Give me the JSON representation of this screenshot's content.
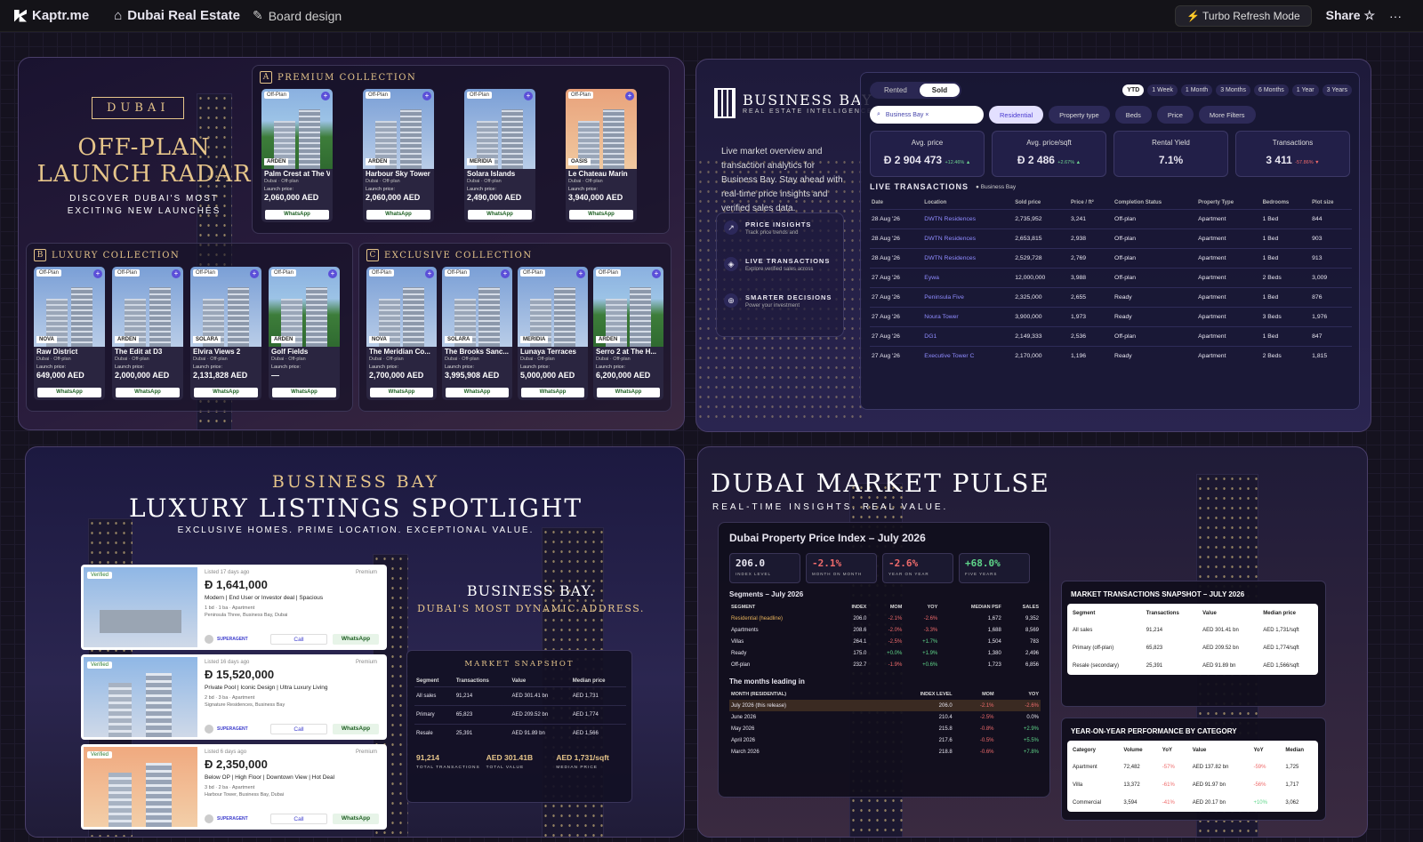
{
  "topbar": {
    "app_name": "Kaptr.me",
    "board_name": "Dubai Real Estate",
    "board_action": "Board design",
    "turbo": "⚡ Turbo Refresh Mode",
    "share": "Share",
    "more": "···"
  },
  "offplan": {
    "tag": "DUBAI",
    "title_1": "OFF-PLAN",
    "title_2": "LAUNCH RADAR",
    "sub_1": "DISCOVER DUBAI'S MOST",
    "sub_2": "EXCITING NEW LAUNCHES",
    "collections": [
      {
        "badge": "A",
        "title": "PREMIUM COLLECTION",
        "cards": [
          {
            "dev": "ARDEN",
            "name": "Palm Crest at The Valley",
            "meta": "Dubai · Off-plan",
            "launch": "Launch price:",
            "price": "2,060,000 AED",
            "img": "g"
          },
          {
            "dev": "ARDEN",
            "name": "Harbour Sky Tower",
            "meta": "Dubai · Off-plan",
            "launch": "Launch price:",
            "price": "2,060,000 AED",
            "img": "b"
          },
          {
            "dev": "MERIDIA",
            "name": "Solara Islands",
            "meta": "Dubai · Off-plan",
            "launch": "Launch price:",
            "price": "2,490,000 AED",
            "img": "b"
          },
          {
            "dev": "OASIS",
            "name": "Le Chateau Marin",
            "meta": "Dubai · Off-plan",
            "launch": "Launch price:",
            "price": "3,940,000 AED",
            "img": "o"
          }
        ]
      },
      {
        "badge": "B",
        "title": "LUXURY COLLECTION",
        "cards": [
          {
            "dev": "NOVA",
            "name": "Raw District",
            "meta": "Dubai · Off-plan",
            "launch": "Launch price:",
            "price": "649,000 AED",
            "img": "b"
          },
          {
            "dev": "ARDEN",
            "name": "The Edit at D3",
            "meta": "Dubai · Off-plan",
            "launch": "Launch price:",
            "price": "2,000,000 AED",
            "img": "b"
          },
          {
            "dev": "SOLARA",
            "name": "Elvira Views 2",
            "meta": "Dubai · Off-plan",
            "launch": "Launch price:",
            "price": "2,131,828 AED",
            "img": "b"
          },
          {
            "dev": "ARDEN",
            "name": "Golf Fields",
            "meta": "Dubai · Off-plan",
            "launch": "Launch price:",
            "price": "—",
            "img": "g"
          }
        ]
      },
      {
        "badge": "C",
        "title": "EXCLUSIVE COLLECTION",
        "cards": [
          {
            "dev": "NOVA",
            "name": "The Meridian Co...",
            "meta": "Dubai · Off-plan",
            "launch": "Launch price:",
            "price": "2,700,000 AED",
            "img": "b"
          },
          {
            "dev": "SOLARA",
            "name": "The Brooks Sanc...",
            "meta": "Dubai · Off-plan",
            "launch": "Launch price:",
            "price": "3,995,908 AED",
            "img": "b"
          },
          {
            "dev": "MERIDIA",
            "name": "Lunaya Terraces",
            "meta": "Dubai · Off-plan",
            "launch": "Launch price:",
            "price": "5,000,000 AED",
            "img": "b"
          },
          {
            "dev": "ARDEN",
            "name": "Serro 2 at The H...",
            "meta": "Dubai · Off-plan",
            "launch": "Launch price:",
            "price": "6,200,000 AED",
            "img": "g"
          }
        ]
      }
    ],
    "card_tag": "Off-Plan",
    "whatsapp": "WhatsApp"
  },
  "bb": {
    "title": "BUSINESS BAY",
    "subtitle": "REAL ESTATE INTELLIGENCE",
    "desc": "Live market overview and transaction analytics for Business Bay. Stay ahead with real-time price insights and verified sales data.",
    "features": [
      {
        "h": "PRICE INSIGHTS",
        "d": "Track price trends and",
        "icon": "↗"
      },
      {
        "h": "LIVE TRANSACTIONS",
        "d": "Explore verified sales across",
        "icon": "◈"
      },
      {
        "h": "SMARTER DECISIONS",
        "d": "Power your investment",
        "icon": "⊕"
      }
    ],
    "toggle": [
      "Rented",
      "Sold"
    ],
    "periods": [
      "YTD",
      "1 Week",
      "1 Month",
      "3 Months",
      "6 Months",
      "1 Year",
      "3 Years"
    ],
    "search_chip": "Business Bay ×",
    "filters": [
      "Residential",
      "Property type",
      "Beds",
      "Price",
      "More Filters"
    ],
    "kpis": [
      {
        "label": "Avg. price",
        "value": "Đ 2 904 473",
        "delta": "+12.46% ▲",
        "dir": "up"
      },
      {
        "label": "Avg. price/sqft",
        "value": "Đ 2 486",
        "delta": "+2.67% ▲",
        "dir": "up"
      },
      {
        "label": "Rental Yield",
        "value": "7.1%",
        "delta": "",
        "dir": "up"
      },
      {
        "label": "Transactions",
        "value": "3 411",
        "delta": "-57.86% ▼",
        "dir": "down"
      }
    ],
    "live_title": "LIVE TRANSACTIONS",
    "live_loc": "● Business Bay",
    "columns": [
      "Date",
      "Location",
      "Sold price",
      "Price / ft²",
      "Completion Status",
      "Property Type",
      "Bedrooms",
      "Plot size"
    ],
    "rows": [
      [
        "28 Aug '26",
        "DWTN Residences",
        "2,735,952",
        "3,241",
        "Off-plan",
        "Apartment",
        "1 Bed",
        "844"
      ],
      [
        "28 Aug '26",
        "DWTN Residences",
        "2,653,815",
        "2,938",
        "Off-plan",
        "Apartment",
        "1 Bed",
        "903"
      ],
      [
        "28 Aug '26",
        "DWTN Residences",
        "2,529,728",
        "2,769",
        "Off-plan",
        "Apartment",
        "1 Bed",
        "913"
      ],
      [
        "27 Aug '26",
        "Eywa",
        "12,000,000",
        "3,988",
        "Off-plan",
        "Apartment",
        "2 Beds",
        "3,009"
      ],
      [
        "27 Aug '26",
        "Peninsula Five",
        "2,325,000",
        "2,655",
        "Ready",
        "Apartment",
        "1 Bed",
        "876"
      ],
      [
        "27 Aug '26",
        "Noura Tower",
        "3,900,000",
        "1,973",
        "Ready",
        "Apartment",
        "3 Beds",
        "1,976"
      ],
      [
        "27 Aug '26",
        "DG1",
        "2,149,333",
        "2,536",
        "Off-plan",
        "Apartment",
        "1 Bed",
        "847"
      ],
      [
        "27 Aug '26",
        "Executive Tower C",
        "2,170,000",
        "1,196",
        "Ready",
        "Apartment",
        "2 Beds",
        "1,815"
      ]
    ]
  },
  "spot": {
    "top": "BUSINESS BAY",
    "title": "LUXURY LISTINGS SPOTLIGHT",
    "sub": "EXCLUSIVE HOMES. PRIME LOCATION. EXCEPTIONAL VALUE.",
    "verified": "Verified",
    "premium": "Premium",
    "agent": "SUPERAGENT",
    "call": "Call",
    "whatsapp": "WhatsApp",
    "listings": [
      {
        "ago": "Listed 17 days ago",
        "price": "Đ 1,641,000",
        "feat": "Modern | End User or Investor deal | Spacious",
        "spec": "1 bd  ·  1 ba  ·  Apartment",
        "addr": "Peninsula Three, Business Bay, Dubai",
        "img": "a"
      },
      {
        "ago": "Listed 16 days ago",
        "price": "Đ 15,520,000",
        "feat": "Private Pool | Iconic Design | Ultra Luxury Living",
        "spec": "2 bd  ·  3 ba  ·  Apartment",
        "addr": "Signature Residences, Business Bay",
        "img": "b"
      },
      {
        "ago": "Listed 6 days ago",
        "price": "Đ 2,350,000",
        "feat": "Below OP | High Floor | Downtown View | Hot Deal",
        "spec": "3 bd  ·  2 ba  ·  Apartment",
        "addr": "Harbour Tower, Business Bay, Dubai",
        "img": "o"
      }
    ],
    "bb_title": "BUSINESS BAY.",
    "bb_sub": "DUBAI'S MOST DYNAMIC ADDRESS.",
    "snap_title": "MARKET SNAPSHOT",
    "snap_cols": [
      "Segment",
      "Transactions",
      "Value",
      "Median price"
    ],
    "snap_rows": [
      [
        "All sales",
        "91,214",
        "AED 301.41 bn",
        "AED 1,731"
      ],
      [
        "Primary",
        "65,823",
        "AED 209.52 bn",
        "AED 1,774"
      ],
      [
        "Resale",
        "25,391",
        "AED 91.89 bn",
        "AED 1,566"
      ]
    ],
    "totals": [
      {
        "v": "91,214",
        "l": "TOTAL TRANSACTIONS"
      },
      {
        "v": "AED 301.41B",
        "l": "TOTAL VALUE"
      },
      {
        "v": "AED 1,731/sqft",
        "l": "MEDIAN PRICE"
      }
    ]
  },
  "pulse": {
    "title": "DUBAI MARKET PULSE",
    "sub": "REAL-TIME INSIGHTS.  REAL VALUE.",
    "index_title": "Dubai Property Price Index – July 2026",
    "tiles": [
      {
        "v": "206.0",
        "l": "INDEX LEVEL",
        "c": ""
      },
      {
        "v": "-2.1%",
        "l": "MONTH ON MONTH",
        "c": "red"
      },
      {
        "v": "-2.6%",
        "l": "YEAR ON YEAR",
        "c": "red"
      },
      {
        "v": "+68.0%",
        "l": "FIVE YEARS",
        "c": "grn"
      }
    ],
    "seg_title": "Segments – July 2026",
    "seg_cols": [
      "SEGMENT",
      "INDEX",
      "MOM",
      "YOY",
      "MEDIAN PSF",
      "SALES"
    ],
    "seg_rows": [
      [
        "Residential (headline)",
        "206.0",
        "-2.1%",
        "-2.6%",
        "1,672",
        "9,352"
      ],
      [
        "Apartments",
        "208.6",
        "-2.0%",
        "-3.3%",
        "1,688",
        "8,569"
      ],
      [
        "Villas",
        "264.1",
        "-2.5%",
        "+1.7%",
        "1,504",
        "783"
      ],
      [
        "Ready",
        "175.0",
        "+0.0%",
        "+1.9%",
        "1,380",
        "2,496"
      ],
      [
        "Off-plan",
        "232.7",
        "-1.9%",
        "+0.6%",
        "1,723",
        "6,856"
      ]
    ],
    "months_title": "The months leading in",
    "month_cols": [
      "MONTH (RESIDENTIAL)",
      "INDEX LEVEL",
      "MOM",
      "YOY"
    ],
    "month_rows": [
      [
        "July 2026 (this release)",
        "206.0",
        "-2.1%",
        "-2.6%"
      ],
      [
        "June 2026",
        "210.4",
        "-2.5%",
        "0.0%"
      ],
      [
        "May 2026",
        "215.8",
        "-0.8%",
        "+2.9%"
      ],
      [
        "April 2026",
        "217.6",
        "-0.5%",
        "+5.5%"
      ],
      [
        "March 2026",
        "218.8",
        "-0.6%",
        "+7.8%"
      ]
    ],
    "mts_title": "MARKET TRANSACTIONS SNAPSHOT – JULY 2026",
    "mts_cols": [
      "Segment",
      "Transactions",
      "Value",
      "Median price"
    ],
    "mts_rows": [
      [
        "All sales",
        "91,214",
        "AED 301.41 bn",
        "AED 1,731/sqft"
      ],
      [
        "Primary (off-plan)",
        "65,823",
        "AED 209.52 bn",
        "AED 1,774/sqft"
      ],
      [
        "Resale (secondary)",
        "25,391",
        "AED 91.89 bn",
        "AED 1,566/sqft"
      ]
    ],
    "yoy_title": "YEAR-ON-YEAR PERFORMANCE BY CATEGORY",
    "yoy_cols": [
      "Category",
      "Volume",
      "YoY",
      "Value",
      "YoY",
      "Median"
    ],
    "yoy_rows": [
      [
        "Apartment",
        "72,482",
        "-57%",
        "AED 137.82 bn",
        "-59%",
        "1,725"
      ],
      [
        "Villa",
        "13,372",
        "-61%",
        "AED 91.97 bn",
        "-56%",
        "1,717"
      ],
      [
        "Commercial",
        "3,594",
        "-41%",
        "AED 20.17 bn",
        "+10%",
        "3,062"
      ]
    ]
  }
}
